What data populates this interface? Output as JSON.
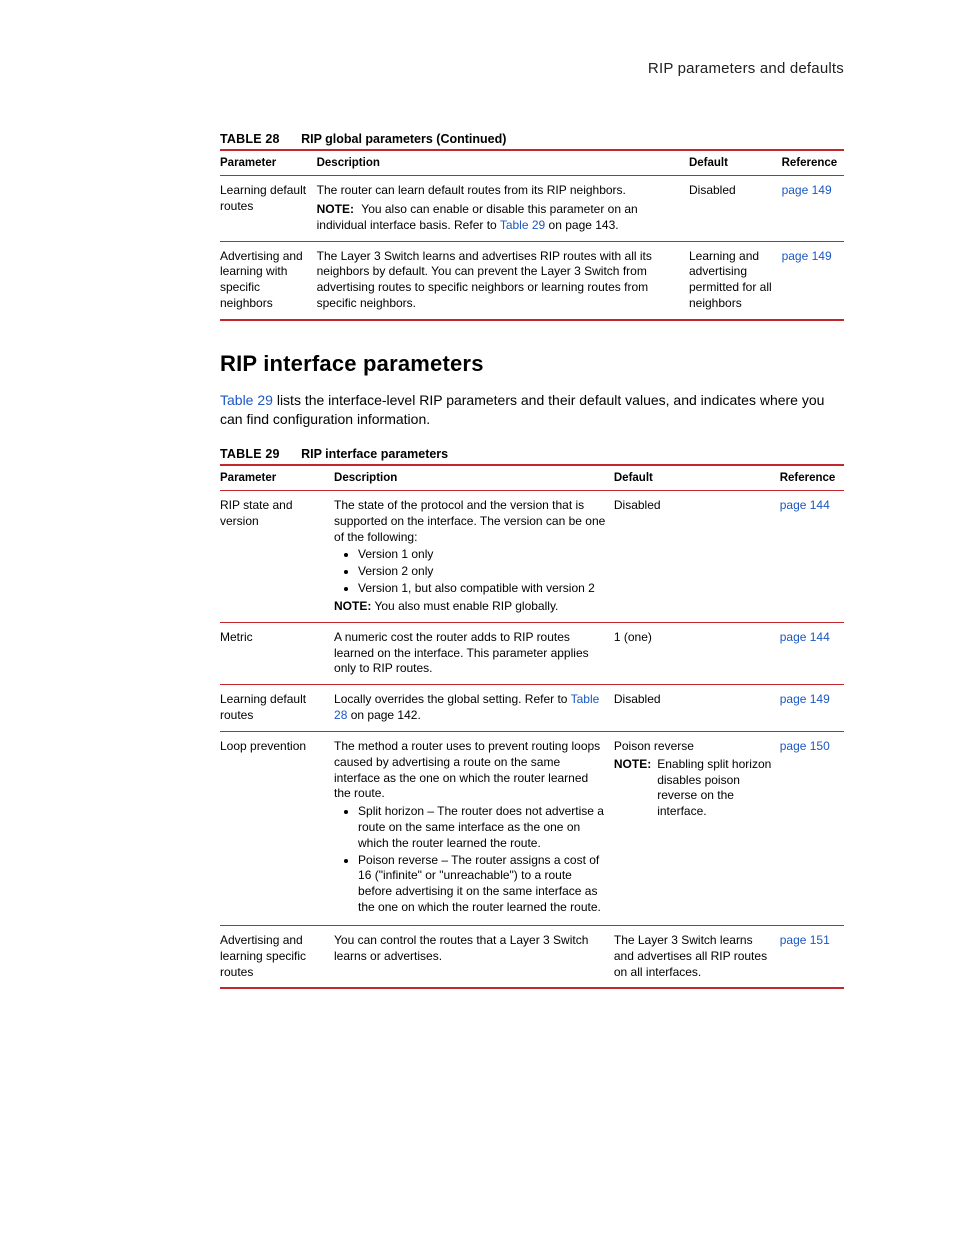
{
  "running_head": "RIP parameters and defaults",
  "table28": {
    "label": "TABLE 28",
    "title": "RIP global parameters (Continued)",
    "headers": [
      "Parameter",
      "Description",
      "Default",
      "Reference"
    ],
    "rows": [
      {
        "param": "Learning default routes",
        "desc_main": "The router can learn default routes from its RIP neighbors.",
        "note_prefix": "NOTE:",
        "note_text1": "You also can enable or disable this parameter on an individual interface basis.  Refer to ",
        "note_link": "Table 29",
        "note_text2": " on page 143.",
        "default": "Disabled",
        "reference": "page 149"
      },
      {
        "param": "Advertising and learning with specific neighbors",
        "desc_main": "The Layer 3 Switch learns and advertises RIP routes with all its neighbors by default.  You can prevent the Layer 3 Switch from advertising routes to specific neighbors or learning routes from specific neighbors.",
        "default": "Learning and advertising permitted for all neighbors",
        "reference": "page 149"
      }
    ]
  },
  "section": {
    "heading": "RIP interface parameters",
    "intro_link": "Table 29",
    "intro_rest": " lists the interface-level RIP parameters and their default values, and indicates where you can find configuration information."
  },
  "table29": {
    "label": "TABLE 29",
    "title": "RIP interface parameters",
    "headers": [
      "Parameter",
      "Description",
      "Default",
      "Reference"
    ],
    "rows": {
      "r0": {
        "param": "RIP state and version",
        "desc_main": "The state of the protocol and the version that is supported on the interface.  The version can be one of the following:",
        "bullets": [
          "Version 1 only",
          "Version 2 only",
          "Version 1, but also compatible with version 2"
        ],
        "note_prefix": "NOTE:",
        "note_text": "You also must enable RIP globally.",
        "default": "Disabled",
        "reference": "page 144"
      },
      "r1": {
        "param": "Metric",
        "desc_main": "A numeric cost the router adds to RIP routes learned on the interface.  This parameter applies only to RIP routes.",
        "default": "1 (one)",
        "reference": "page 144"
      },
      "r2": {
        "param": "Learning default routes",
        "desc_pre": "Locally overrides the global setting.  Refer to ",
        "desc_link": "Table 28",
        "desc_post": " on page 142.",
        "default": "Disabled",
        "reference": "page 149"
      },
      "r3": {
        "param": "Loop prevention",
        "desc_main": "The method a router uses to prevent routing loops caused by advertising a route on the same interface as the one on which the router learned the route.",
        "bullets": [
          "Split horizon – The router does not advertise a route on the same interface as the one on which the router learned the route.",
          "Poison reverse – The router assigns a cost of 16 (\"infinite\" or \"unreachable\") to a route before advertising it on the same interface as the one on which the router learned the route."
        ],
        "default_main": "Poison reverse",
        "default_note_prefix": "NOTE:",
        "default_note_text": "Enabling split horizon disables poison reverse on the interface.",
        "reference": "page 150"
      },
      "r4": {
        "param": "Advertising and learning specific routes",
        "desc_main": "You can control the routes that a Layer 3 Switch learns or advertises.",
        "default": "The Layer 3 Switch learns and advertises all RIP routes on all interfaces.",
        "reference": "page 151"
      }
    }
  }
}
